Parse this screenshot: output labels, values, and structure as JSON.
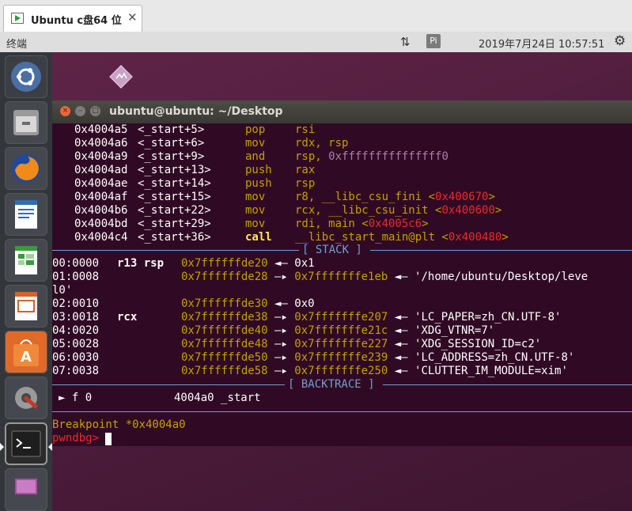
{
  "vm_tab": {
    "title": "Ubuntu c盘64 位",
    "close": "✕"
  },
  "panel": {
    "app_name": "终端",
    "network_glyph": "⇅",
    "input_method": "Pi",
    "clock": "2019年7月24日 10:57:51",
    "settings_glyph": "⚙"
  },
  "launcher": {
    "icons": [
      "ubuntu-logo-icon",
      "files-icon",
      "firefox-icon",
      "writer-icon",
      "calc-icon",
      "impress-icon",
      "software-center-icon",
      "settings-icon",
      "terminal-icon",
      "workspace-switcher-icon"
    ]
  },
  "terminal": {
    "title": "ubuntu@ubuntu: ~/Desktop",
    "disasm": [
      {
        "addr": "0x4004a5",
        "sym": "<_start+5>",
        "op": "pop",
        "args": [
          {
            "t": "rsi",
            "c": "yl"
          }
        ]
      },
      {
        "addr": "0x4004a6",
        "sym": "<_start+6>",
        "op": "mov",
        "args": [
          {
            "t": "rdx, rsp",
            "c": "yl"
          }
        ]
      },
      {
        "addr": "0x4004a9",
        "sym": "<_start+9>",
        "op": "and",
        "args": [
          {
            "t": "rsp, ",
            "c": "yl"
          },
          {
            "t": "0xfffffffffffffff0",
            "c": "pu"
          }
        ]
      },
      {
        "addr": "0x4004ad",
        "sym": "<_start+13>",
        "op": "push",
        "args": [
          {
            "t": "rax",
            "c": "yl"
          }
        ]
      },
      {
        "addr": "0x4004ae",
        "sym": "<_start+14>",
        "op": "push",
        "args": [
          {
            "t": "rsp",
            "c": "yl"
          }
        ]
      },
      {
        "addr": "0x4004af",
        "sym": "<_start+15>",
        "op": "mov",
        "args": [
          {
            "t": "r8, __libc_csu_fini <",
            "c": "yl"
          },
          {
            "t": "0x400670",
            "c": "rd"
          },
          {
            "t": ">",
            "c": "yl"
          }
        ]
      },
      {
        "addr": "0x4004b6",
        "sym": "<_start+22>",
        "op": "mov",
        "args": [
          {
            "t": "rcx, __libc_csu_init <",
            "c": "yl"
          },
          {
            "t": "0x400600",
            "c": "rd"
          },
          {
            "t": ">",
            "c": "yl"
          }
        ]
      },
      {
        "addr": "0x4004bd",
        "sym": "<_start+29>",
        "op": "mov",
        "args": [
          {
            "t": "rdi, main <",
            "c": "yl"
          },
          {
            "t": "0x4005c6",
            "c": "rd"
          },
          {
            "t": ">",
            "c": "yl"
          }
        ]
      },
      {
        "addr": "0x4004c4",
        "sym": "<_start+36>",
        "op": "call",
        "args": [
          {
            "t": "__libc_start_main@plt <",
            "c": "yl"
          },
          {
            "t": "0x400480",
            "c": "rd"
          },
          {
            "t": ">",
            "c": "yl"
          }
        ]
      }
    ],
    "stack_header": "[ STACK ]",
    "stack": [
      {
        "idx": "00:0000",
        "regs": "r13 rsp",
        "addr": "0x7ffffffde20",
        "rest": [
          {
            "t": " ◄— 0x1",
            "c": "wh"
          }
        ]
      },
      {
        "idx": "01:0008",
        "regs": "",
        "addr": "0x7ffffffde28",
        "rest": [
          {
            "t": " —▸ ",
            "c": "wh"
          },
          {
            "t": "0x7fffffffe1eb",
            "c": "yl"
          },
          {
            "t": " ◄— '/home/ubuntu/Desktop/leve",
            "c": "wh"
          }
        ]
      },
      {
        "idx": "",
        "regs": "",
        "addr": "",
        "rest": [
          {
            "t": "l0'",
            "c": "wh"
          }
        ]
      },
      {
        "idx": "02:0010",
        "regs": "",
        "addr": "0x7ffffffde30",
        "rest": [
          {
            "t": " ◄— 0x0",
            "c": "wh"
          }
        ]
      },
      {
        "idx": "03:0018",
        "regs": "rcx",
        "addr": "0x7ffffffde38",
        "rest": [
          {
            "t": " —▸ ",
            "c": "wh"
          },
          {
            "t": "0x7fffffffe207",
            "c": "yl"
          },
          {
            "t": " ◄— 'LC_PAPER=zh_CN.UTF-8'",
            "c": "wh"
          }
        ]
      },
      {
        "idx": "04:0020",
        "regs": "",
        "addr": "0x7ffffffde40",
        "rest": [
          {
            "t": " —▸ ",
            "c": "wh"
          },
          {
            "t": "0x7fffffffe21c",
            "c": "yl"
          },
          {
            "t": " ◄— 'XDG_VTNR=7'",
            "c": "wh"
          }
        ]
      },
      {
        "idx": "05:0028",
        "regs": "",
        "addr": "0x7ffffffde48",
        "rest": [
          {
            "t": " —▸ ",
            "c": "wh"
          },
          {
            "t": "0x7fffffffe227",
            "c": "yl"
          },
          {
            "t": " ◄— 'XDG_SESSION_ID=c2'",
            "c": "wh"
          }
        ]
      },
      {
        "idx": "06:0030",
        "regs": "",
        "addr": "0x7ffffffde50",
        "rest": [
          {
            "t": " —▸ ",
            "c": "wh"
          },
          {
            "t": "0x7fffffffe239",
            "c": "yl"
          },
          {
            "t": " ◄— 'LC_ADDRESS=zh_CN.UTF-8'",
            "c": "wh"
          }
        ]
      },
      {
        "idx": "07:0038",
        "regs": "",
        "addr": "0x7ffffffde58",
        "rest": [
          {
            "t": " —▸ ",
            "c": "wh"
          },
          {
            "t": "0x7fffffffe250",
            "c": "yl"
          },
          {
            "t": " ◄— 'CLUTTER_IM_MODULE=xim'",
            "c": "wh"
          }
        ]
      }
    ],
    "backtrace_header": "[ BACKTRACE ]",
    "backtrace": {
      "marker": "►",
      "frame": "f 0",
      "addr": "4004a0",
      "sym": "_start"
    },
    "breakpoint": "Breakpoint *0x4004a0",
    "prompt": "pwndbg>"
  }
}
